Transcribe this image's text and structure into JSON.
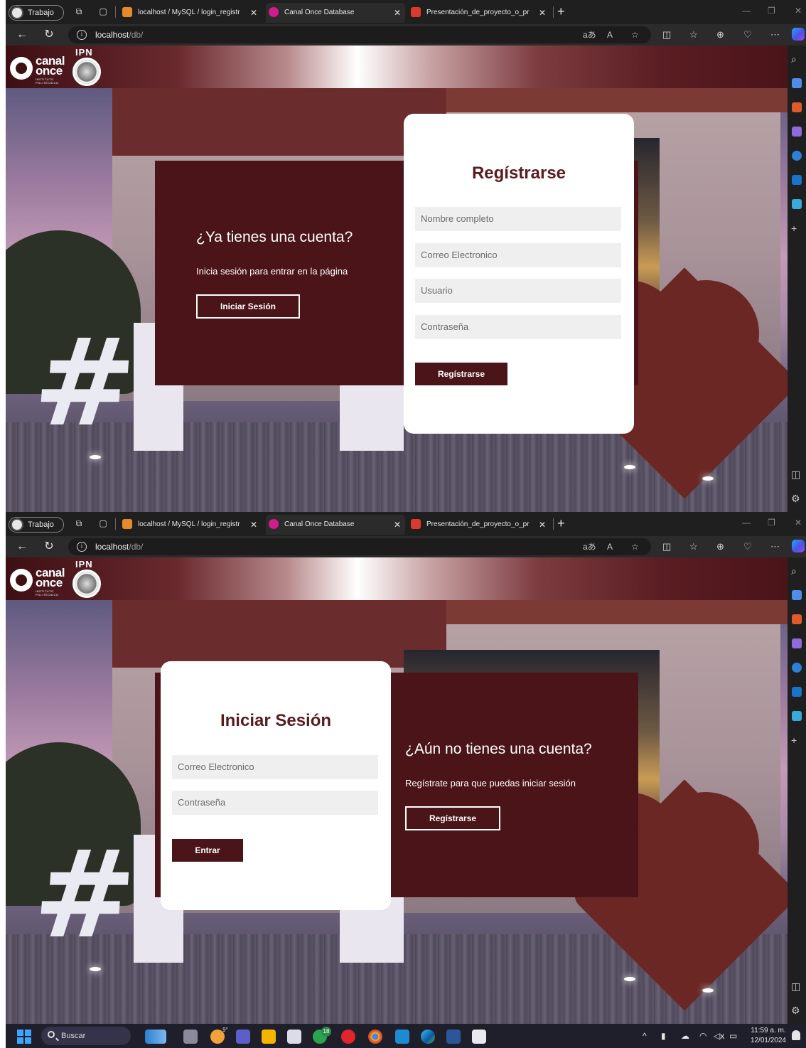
{
  "browser": {
    "profile_label": "Trabajo",
    "tabs": [
      {
        "title": "localhost / MySQL / login_registr"
      },
      {
        "title": "Canal Once Database"
      },
      {
        "title": "Presentación_de_proyecto_o_pr"
      }
    ],
    "url_host": "localhost",
    "url_path": "/db/"
  },
  "site": {
    "logo_word1": "canal",
    "logo_word2": "once",
    "logo_tagline": "INSTITUTO POLITÉCNICO",
    "ipn_text": "IPN"
  },
  "register_view": {
    "panel_title": "¿Ya tienes una cuenta?",
    "panel_text": "Inicia sesión para entrar en la página",
    "panel_button": "Iniciar Sesión",
    "card_title": "Regístrarse",
    "fields": [
      {
        "placeholder": "Nombre completo"
      },
      {
        "placeholder": "Correo Electronico"
      },
      {
        "placeholder": "Usuario"
      },
      {
        "placeholder": "Contraseña"
      }
    ],
    "submit_label": "Regístrarse"
  },
  "login_view": {
    "card_title": "Iniciar Sesión",
    "fields": [
      {
        "placeholder": "Correo Electronico"
      },
      {
        "placeholder": "Contraseña"
      }
    ],
    "submit_label": "Entrar",
    "panel_title": "¿Aún no tienes una cuenta?",
    "panel_text": "Regístrate para que puedas iniciar sesión",
    "panel_button": "Regístrarse"
  },
  "taskbar": {
    "search_label": "Buscar",
    "weather_temp": "9°",
    "badge_count": "18",
    "time": "11:59 a. m.",
    "date": "12/01/2024"
  },
  "colors": {
    "brand_dark": "#4a1418",
    "title_color": "#5a1b1f",
    "field_bg": "#efefef"
  }
}
